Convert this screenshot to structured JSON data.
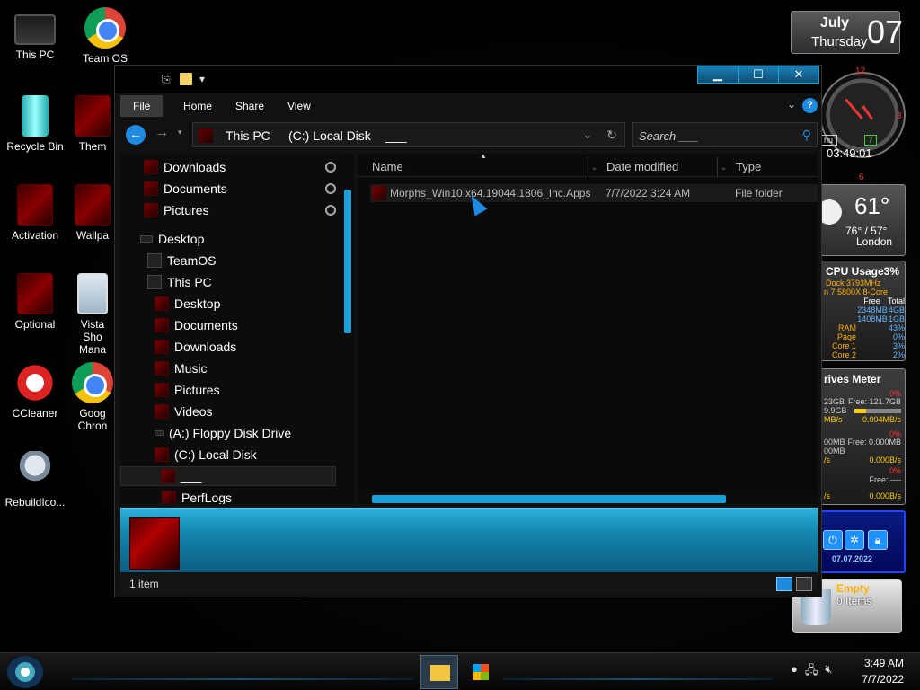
{
  "desktop_icons": [
    {
      "label": "This PC"
    },
    {
      "label": "Team OS"
    },
    {
      "label": "Recycle Bin"
    },
    {
      "label": "Them"
    },
    {
      "label": "Activation"
    },
    {
      "label": "Wallpa"
    },
    {
      "label": "Optional"
    },
    {
      "label": "Vista Sho Mana"
    },
    {
      "label": "CCleaner"
    },
    {
      "label": "Goog Chron"
    },
    {
      "label": "RebuildIco..."
    }
  ],
  "clock_widget": {
    "month": "July",
    "weekday": "Thursday",
    "day": "07"
  },
  "analog_clock": {
    "box1": "hu",
    "box2": "7",
    "digital_time": "03:49:01",
    "mark12": "12",
    "mark3": "3",
    "mark6": "6"
  },
  "weather": {
    "temp": "61°",
    "range": "76° / 57°",
    "city": "London"
  },
  "cpu_meter": {
    "title": "CPU Usage",
    "percent": "3%",
    "clock": "Dock:3793MHz",
    "model": "n 7 5800X 8-Core",
    "header": {
      "a": "Free",
      "b": "Total"
    },
    "rows": [
      {
        "label": "",
        "a": "2348MB",
        "b": "4GB"
      },
      {
        "label": "",
        "a": "1408MB",
        "b": "1GB"
      },
      {
        "label": "RAM",
        "a": "",
        "b": "43%"
      },
      {
        "label": "Page",
        "a": "",
        "b": "0%"
      },
      {
        "label": "Core 1",
        "a": "",
        "b": "3%"
      },
      {
        "label": "Core 2",
        "a": "",
        "b": "2%"
      }
    ]
  },
  "drives_meter": {
    "title": "rives Meter",
    "d1_pct": "0%",
    "d1_used": "23GB",
    "d1_free": "Free: 121.7GB",
    "d1_size": "9.9GB",
    "d1_fill": 0.25,
    "d1_read": "MB/s",
    "d1_write": "0.004MB/s",
    "d2_pct": "0%",
    "d2_used": "00MB",
    "d2_free": "Free: 0.000MB",
    "d2_size": "00MB",
    "d2_read": "/s",
    "d2_write": "0.000B/s",
    "d3_pct": "0%",
    "d3_free": "Free: ----",
    "d3_read": "/s",
    "d3_write": "0.000B/s"
  },
  "launcher": {
    "date": "07.07.2022"
  },
  "recycle_widget": {
    "status": "Empty",
    "items": "0 Items"
  },
  "explorer": {
    "ribbon_tabs": [
      "File",
      "Home",
      "Share",
      "View"
    ],
    "address": {
      "this_pc": "This PC",
      "drive": "(C:) Local Disk",
      "folder": "___"
    },
    "search_placeholder": "Search ___",
    "nav_items": [
      {
        "label": "Downloads"
      },
      {
        "label": "Documents"
      },
      {
        "label": "Pictures"
      },
      {
        "label": "Desktop"
      },
      {
        "label": "TeamOS"
      },
      {
        "label": "This PC"
      },
      {
        "label": "Desktop"
      },
      {
        "label": "Documents"
      },
      {
        "label": "Downloads"
      },
      {
        "label": "Music"
      },
      {
        "label": "Pictures"
      },
      {
        "label": "Videos"
      },
      {
        "label": "(A:) Floppy Disk Drive"
      },
      {
        "label": "(C:) Local Disk"
      },
      {
        "label": "___"
      },
      {
        "label": "PerfLogs"
      }
    ],
    "columns": {
      "name": "Name",
      "date": "Date modified",
      "type": "Type"
    },
    "files": [
      {
        "name": "Morphs_Win10.x64.19044.1806_Inc.Apps ...",
        "date": "7/7/2022 3:24 AM",
        "type": "File folder"
      }
    ],
    "status": "1 item"
  },
  "taskbar": {
    "time": "3:49 AM",
    "date": "7/7/2022"
  }
}
